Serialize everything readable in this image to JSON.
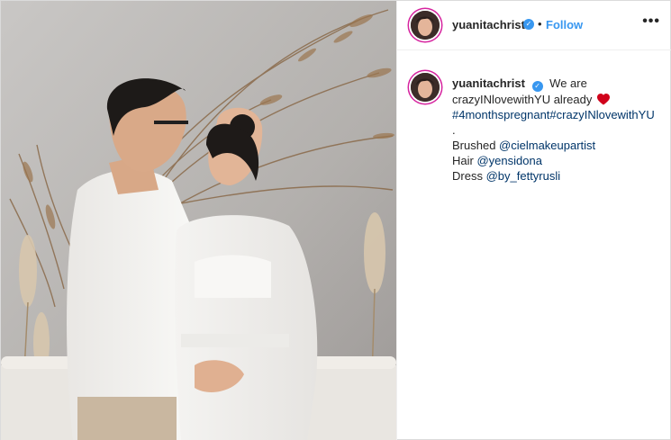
{
  "post": {
    "username": "yuanitachrist",
    "verified_icon": "verified-badge-icon",
    "separator": "•",
    "follow_label": "Follow",
    "more_label": "•••",
    "caption": {
      "text_1": "We are",
      "text_2": "crazyINlovewithYU already",
      "emoji": "heart-icon",
      "hashtags": "#4monthspregnant#crazyINlovewithYU",
      "dot": ".",
      "brushed_label": "Brushed",
      "brushed_handle": "@cielmakeupartist",
      "hair_label": "Hair",
      "hair_handle": "@yensidona",
      "dress_label": "Dress",
      "dress_handle": "@by_fettyrusli"
    }
  },
  "colors": {
    "link": "#003569",
    "follow": "#3897f0",
    "heart": "#d0021b",
    "verified": "#3897f0"
  }
}
